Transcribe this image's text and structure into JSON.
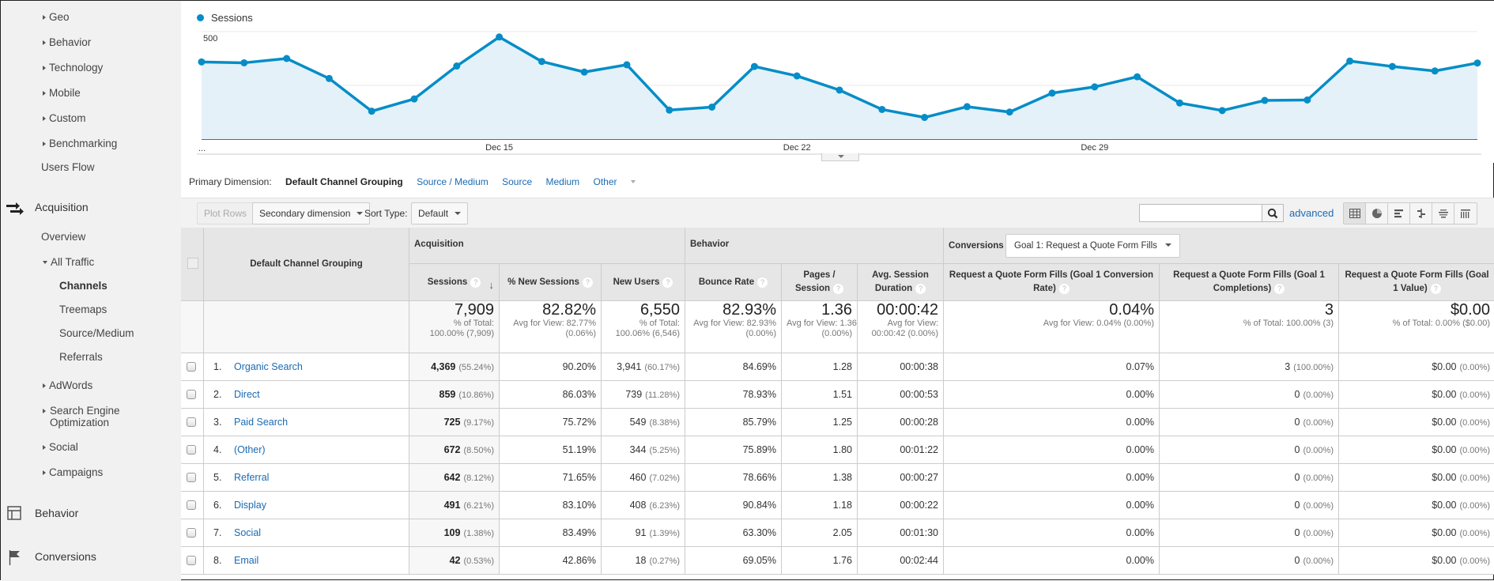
{
  "sidebar": {
    "audience_items": [
      {
        "label": "Geo",
        "expandable": true
      },
      {
        "label": "Behavior",
        "expandable": true
      },
      {
        "label": "Technology",
        "expandable": true
      },
      {
        "label": "Mobile",
        "expandable": true
      },
      {
        "label": "Custom",
        "expandable": true
      },
      {
        "label": "Benchmarking",
        "expandable": true
      },
      {
        "label": "Users Flow",
        "expandable": false
      }
    ],
    "acquisition": {
      "label": "Acquisition",
      "icon": "acquisition-arrows-icon",
      "overview": "Overview",
      "all_traffic": "All Traffic",
      "all_traffic_children": [
        "Channels",
        "Treemaps",
        "Source/Medium",
        "Referrals"
      ],
      "active_child": "Channels",
      "more": [
        "AdWords",
        "Search Engine Optimization",
        "Social",
        "Campaigns"
      ]
    },
    "behavior": {
      "label": "Behavior",
      "icon": "layout-icon"
    },
    "conversions": {
      "label": "Conversions",
      "icon": "flag-icon"
    }
  },
  "chart_data": {
    "type": "area",
    "series": [
      {
        "name": "Sessions",
        "color": "#058dc7",
        "values": [
          359,
          355,
          375,
          282,
          130,
          187,
          340,
          475,
          361,
          312,
          346,
          135,
          149,
          338,
          294,
          228,
          138,
          101,
          151,
          126,
          214,
          243,
          290,
          168,
          133,
          180,
          182,
          363,
          338,
          317,
          354
        ]
      }
    ],
    "x_start_label": "...",
    "x_ticks": [
      {
        "index": 7,
        "label": "Dec 15"
      },
      {
        "index": 14,
        "label": "Dec 22"
      },
      {
        "index": 21,
        "label": "Dec 29"
      }
    ],
    "y_ticks": [
      250,
      500
    ],
    "ylim": [
      0,
      500
    ],
    "grid": true,
    "legend": "top-left"
  },
  "dimension_bar": {
    "label": "Primary Dimension:",
    "active": "Default Channel Grouping",
    "links": [
      "Source / Medium",
      "Source",
      "Medium"
    ],
    "other": "Other"
  },
  "toolbar": {
    "plot_rows": "Plot Rows",
    "secondary_dimension": "Secondary dimension",
    "sort_type_label": "Sort Type:",
    "sort_type_value": "Default",
    "search_value": "",
    "advanced": "advanced",
    "views": [
      "table-view-icon",
      "pie-view-icon",
      "performance-view-icon",
      "comparison-view-icon",
      "term-cloud-icon",
      "pivot-view-icon"
    ]
  },
  "table": {
    "dimension_header": "Default Channel Grouping",
    "groups": {
      "acquisition": "Acquisition",
      "behavior": "Behavior",
      "conversions": "Conversions",
      "goal_select": "Goal 1: Request a Quote Form Fills"
    },
    "columns": [
      "Sessions",
      "% New Sessions",
      "New Users",
      "Bounce Rate",
      "Pages / Session",
      "Avg. Session Duration",
      "Request a Quote Form Fills (Goal 1 Conversion Rate)",
      "Request a Quote Form Fills (Goal 1 Completions)",
      "Request a Quote Form Fills (Goal 1 Value)"
    ],
    "totals": [
      {
        "value": "7,909",
        "sub1": "% of Total:",
        "sub2": "100.00% (7,909)"
      },
      {
        "value": "82.82%",
        "sub1": "Avg for View: 82.77%",
        "sub2": "(0.06%)"
      },
      {
        "value": "6,550",
        "sub1": "% of Total:",
        "sub2": "100.06% (6,546)"
      },
      {
        "value": "82.93%",
        "sub1": "Avg for View: 82.93%",
        "sub2": "(0.00%)"
      },
      {
        "value": "1.36",
        "sub1": "Avg for View: 1.36",
        "sub2": "(0.00%)"
      },
      {
        "value": "00:00:42",
        "sub1": "Avg for View:",
        "sub2": "00:00:42 (0.00%)"
      },
      {
        "value": "0.04%",
        "sub1": "Avg for View: 0.04% (0.00%)",
        "sub2": ""
      },
      {
        "value": "3",
        "sub1": "% of Total: 100.00% (3)",
        "sub2": ""
      },
      {
        "value": "$0.00",
        "sub1": "% of Total: 0.00% ($0.00)",
        "sub2": ""
      }
    ],
    "rows": [
      {
        "idx": "1.",
        "name": "Organic Search",
        "sessions": "4,369",
        "sessions_pct": "(55.24%)",
        "new_sessions": "90.20%",
        "new_users": "3,941",
        "new_users_pct": "(60.17%)",
        "bounce": "84.69%",
        "pages": "1.28",
        "duration": "00:00:38",
        "conv_rate": "0.07%",
        "completions": "3",
        "completions_pct": "(100.00%)",
        "value": "$0.00",
        "value_pct": "(0.00%)"
      },
      {
        "idx": "2.",
        "name": "Direct",
        "sessions": "859",
        "sessions_pct": "(10.86%)",
        "new_sessions": "86.03%",
        "new_users": "739",
        "new_users_pct": "(11.28%)",
        "bounce": "78.93%",
        "pages": "1.51",
        "duration": "00:00:53",
        "conv_rate": "0.00%",
        "completions": "0",
        "completions_pct": "(0.00%)",
        "value": "$0.00",
        "value_pct": "(0.00%)"
      },
      {
        "idx": "3.",
        "name": "Paid Search",
        "sessions": "725",
        "sessions_pct": "(9.17%)",
        "new_sessions": "75.72%",
        "new_users": "549",
        "new_users_pct": "(8.38%)",
        "bounce": "85.79%",
        "pages": "1.25",
        "duration": "00:00:28",
        "conv_rate": "0.00%",
        "completions": "0",
        "completions_pct": "(0.00%)",
        "value": "$0.00",
        "value_pct": "(0.00%)"
      },
      {
        "idx": "4.",
        "name": "(Other)",
        "sessions": "672",
        "sessions_pct": "(8.50%)",
        "new_sessions": "51.19%",
        "new_users": "344",
        "new_users_pct": "(5.25%)",
        "bounce": "75.89%",
        "pages": "1.80",
        "duration": "00:01:22",
        "conv_rate": "0.00%",
        "completions": "0",
        "completions_pct": "(0.00%)",
        "value": "$0.00",
        "value_pct": "(0.00%)"
      },
      {
        "idx": "5.",
        "name": "Referral",
        "sessions": "642",
        "sessions_pct": "(8.12%)",
        "new_sessions": "71.65%",
        "new_users": "460",
        "new_users_pct": "(7.02%)",
        "bounce": "78.66%",
        "pages": "1.38",
        "duration": "00:00:27",
        "conv_rate": "0.00%",
        "completions": "0",
        "completions_pct": "(0.00%)",
        "value": "$0.00",
        "value_pct": "(0.00%)"
      },
      {
        "idx": "6.",
        "name": "Display",
        "sessions": "491",
        "sessions_pct": "(6.21%)",
        "new_sessions": "83.10%",
        "new_users": "408",
        "new_users_pct": "(6.23%)",
        "bounce": "90.84%",
        "pages": "1.18",
        "duration": "00:00:22",
        "conv_rate": "0.00%",
        "completions": "0",
        "completions_pct": "(0.00%)",
        "value": "$0.00",
        "value_pct": "(0.00%)"
      },
      {
        "idx": "7.",
        "name": "Social",
        "sessions": "109",
        "sessions_pct": "(1.38%)",
        "new_sessions": "83.49%",
        "new_users": "91",
        "new_users_pct": "(1.39%)",
        "bounce": "63.30%",
        "pages": "2.05",
        "duration": "00:01:30",
        "conv_rate": "0.00%",
        "completions": "0",
        "completions_pct": "(0.00%)",
        "value": "$0.00",
        "value_pct": "(0.00%)"
      },
      {
        "idx": "8.",
        "name": "Email",
        "sessions": "42",
        "sessions_pct": "(0.53%)",
        "new_sessions": "42.86%",
        "new_users": "18",
        "new_users_pct": "(0.27%)",
        "bounce": "69.05%",
        "pages": "1.76",
        "duration": "00:02:44",
        "conv_rate": "0.00%",
        "completions": "0",
        "completions_pct": "(0.00%)",
        "value": "$0.00",
        "value_pct": "(0.00%)"
      }
    ]
  }
}
